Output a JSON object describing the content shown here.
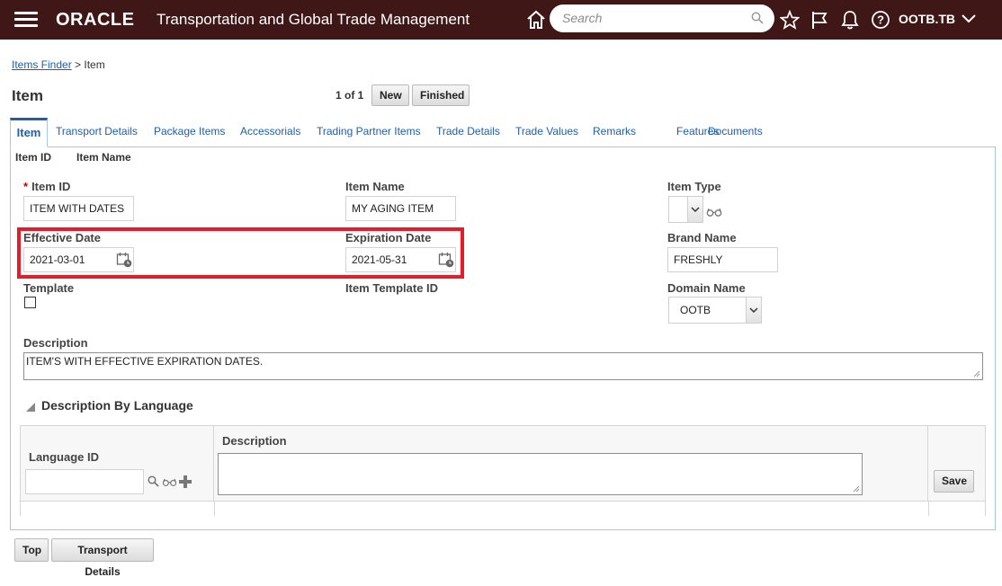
{
  "header": {
    "brand": "ORACLE",
    "app_title": "Transportation and Global Trade Management",
    "search_placeholder": "Search",
    "user": "OOTB.TB",
    "icons": [
      "menu-icon",
      "home-icon",
      "search-icon",
      "star-icon",
      "flag-icon",
      "bell-icon",
      "help-icon",
      "chevron-down-icon"
    ]
  },
  "breadcrumb": {
    "link": "Items Finder",
    "separator": ">",
    "current": "Item"
  },
  "page": {
    "title": "Item",
    "pager": "1 of 1",
    "new_label": "New",
    "finished_label": "Finished"
  },
  "tabs": [
    "Item",
    "Transport Details",
    "Package Items",
    "Accessorials",
    "Trading Partner Items",
    "Trade Details",
    "Trade Values",
    "Remarks",
    "Features",
    "Documents"
  ],
  "subheader": {
    "item_id": "Item ID",
    "item_name": "Item Name"
  },
  "form": {
    "item_id_label": "Item ID",
    "item_id_value": "ITEM WITH DATES",
    "item_name_label": "Item Name",
    "item_name_value": "MY AGING ITEM",
    "item_type_label": "Item Type",
    "item_type_value": "",
    "effective_date_label": "Effective Date",
    "effective_date_value": "2021-03-01",
    "expiration_date_label": "Expiration Date",
    "expiration_date_value": "2021-05-31",
    "brand_name_label": "Brand Name",
    "brand_name_value": "FRESHLY",
    "template_label": "Template",
    "template_checked": false,
    "item_template_id_label": "Item Template ID",
    "domain_name_label": "Domain Name",
    "domain_name_value": "OOTB",
    "description_label": "Description",
    "description_value": "ITEM'S WITH EFFECTIVE EXPIRATION DATES."
  },
  "description_by_language": {
    "title": "Description By Language",
    "language_id_label": "Language ID",
    "language_id_value": "",
    "description_label": "Description",
    "description_value": "",
    "save_label": "Save"
  },
  "footer": {
    "top_label": "Top",
    "transport_details_label": "Transport Details"
  },
  "colors": {
    "header_bg": "#3f1716",
    "link": "#1e5fa8",
    "highlight": "#e31e2a"
  }
}
